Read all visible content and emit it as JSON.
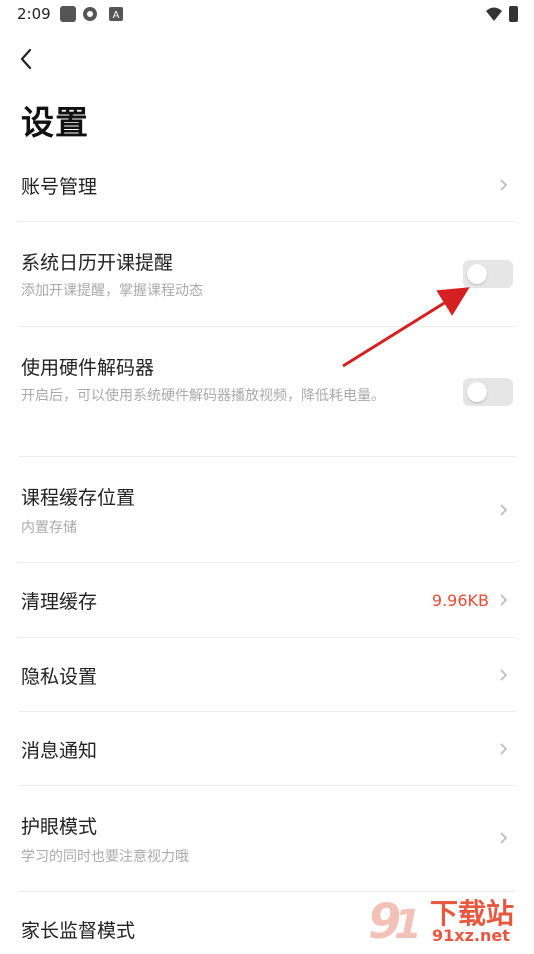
{
  "status": {
    "time": "2:09"
  },
  "header": {
    "title": "设置"
  },
  "rows": [
    {
      "label": "账号管理"
    },
    {
      "label": "系统日历开课提醒",
      "sub": "添加开课提醒，掌握课程动态",
      "toggle": "off"
    },
    {
      "label": "使用硬件解码器",
      "sub": "开启后，可以使用系统硬件解码器播放视频，降低耗电量。",
      "toggle": "off"
    },
    {
      "label": "课程缓存位置",
      "sub": "内置存储"
    },
    {
      "label": "清理缓存",
      "value": "9.96KB"
    },
    {
      "label": "隐私设置"
    },
    {
      "label": "消息通知"
    },
    {
      "label": "护眼模式",
      "sub": "学习的同时也要注意视力哦"
    },
    {
      "label": "家长监督模式"
    }
  ],
  "watermark": {
    "brand": "下载站",
    "url": "91xz.net"
  },
  "colors": {
    "accent": "#e94b35",
    "arrow": "#d42020"
  }
}
